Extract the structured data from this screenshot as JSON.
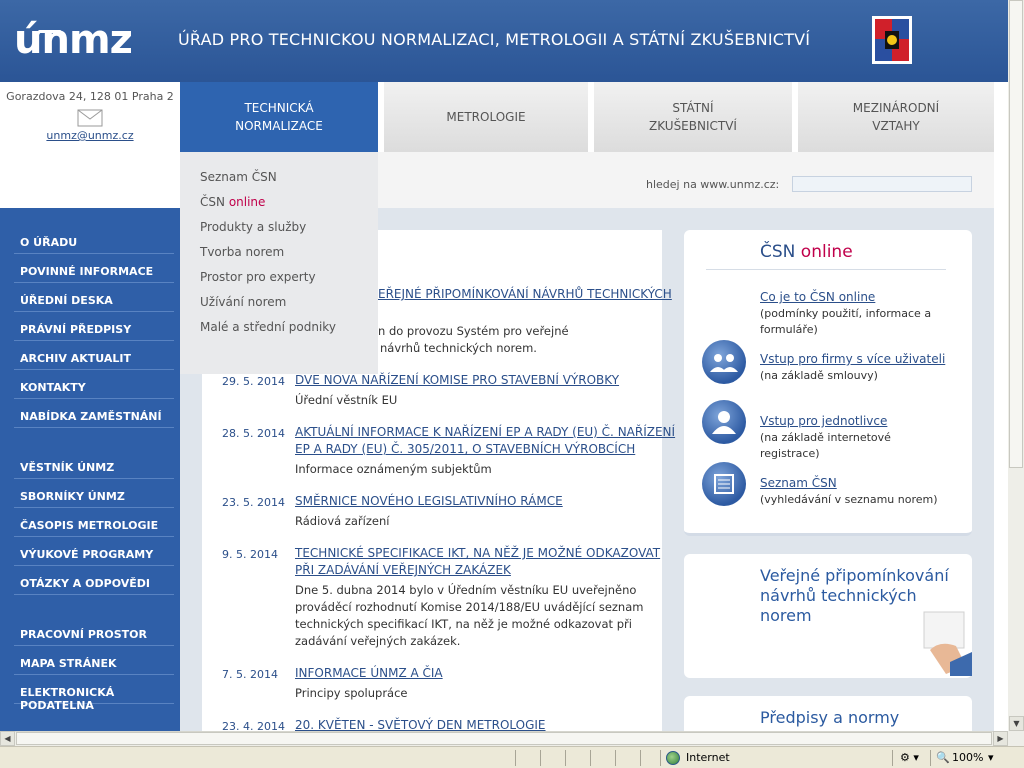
{
  "header": {
    "logo_text": "únmz",
    "title": "ÚŘAD PRO TECHNICKOU NORMALIZACI, METROLOGII A STÁTNÍ ZKUŠEBNICTVÍ"
  },
  "contact": {
    "address": "Gorazdova 24, 128 01 Praha 2",
    "email": "unmz@unmz.cz"
  },
  "tabs": [
    {
      "line1": "TECHNICKÁ",
      "line2": "NORMALIZACE"
    },
    {
      "line1": "METROLOGIE",
      "line2": ""
    },
    {
      "line1": "STÁTNÍ",
      "line2": "ZKUŠEBNICTVÍ"
    },
    {
      "line1": "MEZINÁRODNÍ",
      "line2": "VZTAHY"
    }
  ],
  "dropdown": {
    "items": [
      "Seznam ČSN",
      "ČSN",
      "online",
      "Produkty a služby",
      "Tvorba norem",
      "Prostor pro experty",
      "Užívání norem",
      "Malé a střední podniky"
    ]
  },
  "search": {
    "label": "hledej na www.unmz.cz:",
    "value": ""
  },
  "leftnav": {
    "group1": [
      "O ÚŘADU",
      "POVINNÉ INFORMACE",
      "ÚŘEDNÍ DESKA",
      "PRÁVNÍ PŘEDPISY",
      "ARCHIV AKTUALIT",
      "KONTAKTY",
      "NABÍDKA ZAMĚSTNÁNÍ"
    ],
    "group2": [
      "VĚSTNÍK ÚNMZ",
      "SBORNÍKY ÚNMZ",
      "ČASOPIS METROLOGIE",
      "VÝUKOVÉ PROGRAMY",
      "OTÁZKY A ODPOVĚDI"
    ],
    "group3": [
      "PRACOVNÍ PROSTOR",
      "MAPA STRÁNEK",
      "ELEKTRONICKÁ PODATELNA"
    ]
  },
  "news": {
    "partial": {
      "title": "EŘEJNÉ PŘIPOMÍNKOVÁNÍ NÁVRHŮ TECHNICKÝCH",
      "desc1": "n do provozu Systém pro veřejné",
      "desc2": "návrhů technických norem."
    },
    "items": [
      {
        "date": "29. 5. 2014",
        "title1": "DVĚ NOVÁ NAŘÍZENÍ KOMISE PRO STAVEBNÍ VÝROBKY",
        "title2": "",
        "desc": [
          "Úřední věstník EU"
        ]
      },
      {
        "date": "28. 5. 2014",
        "title1": "AKTUÁLNÍ INFORMACE K NAŘÍZENÍ EP A RADY (EU) Č. NAŘÍZENÍ",
        "title2": "EP A RADY (EU) Č. 305/2011, O STAVEBNÍCH VÝROBCÍCH",
        "desc": [
          "Informace oznámeným subjektům"
        ]
      },
      {
        "date": "23. 5. 2014",
        "title1": "SMĚRNICE NOVÉHO LEGISLATIVNÍHO RÁMCE",
        "title2": "",
        "desc": [
          "Rádiová zařízení"
        ]
      },
      {
        "date": "9. 5. 2014",
        "title1": "TECHNICKÉ SPECIFIKACE IKT, NA NĚŽ JE MOŽNÉ ODKAZOVAT",
        "title2": "PŘI ZADÁVÁNÍ VEŘEJNÝCH ZAKÁZEK",
        "desc": [
          "Dne 5. dubna 2014 bylo v Úředním věstníku EU uveřejněno",
          "prováděcí rozhodnutí Komise 2014/188/EU uvádějící seznam",
          "technických specifikací IKT, na něž je možné odkazovat při",
          "zadávání veřejných zakázek."
        ]
      },
      {
        "date": "7. 5. 2014",
        "title1": "INFORMACE ÚNMZ A ČIA",
        "title2": "",
        "desc": [
          "Principy spolupráce"
        ]
      },
      {
        "date": "23. 4. 2014",
        "title1": "20. KVĚTEN - SVĚTOVÝ DEN METROLOGIE",
        "title2": "",
        "desc": []
      }
    ]
  },
  "csn_online": {
    "title_a": "ČSN",
    "title_b": "online",
    "links": [
      {
        "label": "Co je to ČSN online",
        "desc": "(podmínky použití, informace a formuláře)"
      },
      {
        "label": "Vstup pro firmy s více uživateli",
        "desc": "(na základě smlouvy)"
      },
      {
        "label": "Vstup pro jednotlivce",
        "desc": "(na základě internetové registrace)"
      },
      {
        "label": "Seznam ČSN",
        "desc": "(vyhledávání v seznamu norem)"
      }
    ]
  },
  "promo": {
    "title": "Veřejné připomínkování návrhů technických norem"
  },
  "predpisy": {
    "title": "Předpisy a normy"
  },
  "statusbar": {
    "zone": "Internet",
    "zoom": "100%"
  },
  "colors": {
    "brand_blue": "#2e64b0",
    "accent_red": "#c0004a",
    "arrow_yellow": "#f2c418"
  }
}
